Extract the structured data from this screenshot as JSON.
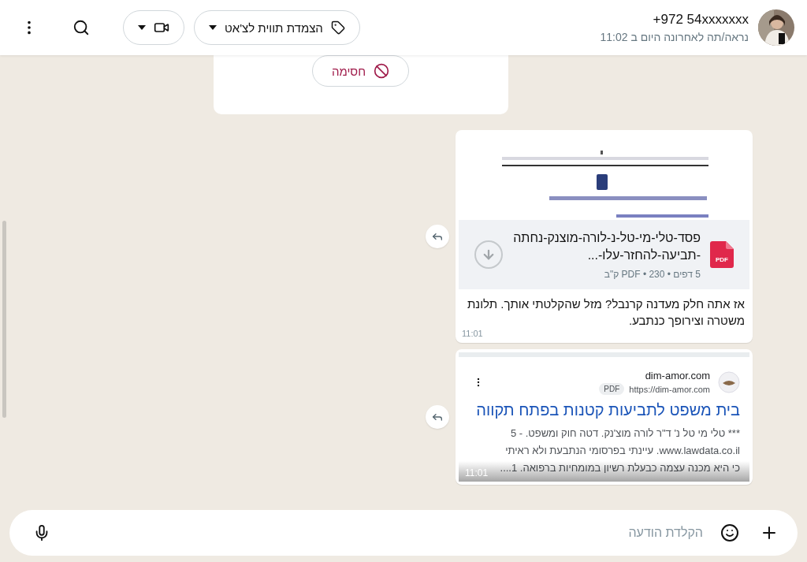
{
  "header": {
    "contact": {
      "name": "+972 54xxxxxxx",
      "status": "נראה/תה לאחרונה היום ב 11:02"
    },
    "label_button": "הצמדת תווית לצ'אט"
  },
  "block_card": {
    "button": "חסימה"
  },
  "messages": [
    {
      "kind": "document",
      "file_type": "PDF",
      "file_name": "פסד-טלי-מי-טל-נ-לורה-מוצנק-נחתה-תביעה-להחזר-עלו-...",
      "file_meta": "5 דפים • PDF • 230 ק\"ב",
      "text": "אז אתה חלק מעדנה קרנבל? מזל שהקלטתי אותך. תלונת משטרה וצירופך כנתבע.",
      "time": "11:01"
    },
    {
      "kind": "link",
      "site": "dim-amor.com",
      "url": "https://dim-amor.com",
      "badge": "PDF",
      "title": "בית משפט לתביעות קטנות בפתח תקווה",
      "snippet": "*** טלי מי טל נ' ד\"ר לורה מוצ'נק. דטה חוק ומשפט. - 5 www.lawdata.co.il. עיינתי בפרסומי הנתבעת ולא ראיתי כי היא מכנה עצמה כבעלת רשיון במומחיות ברפואה. 1....",
      "time": "11:01"
    }
  ],
  "composer": {
    "placeholder": "הקלדת הודעה"
  }
}
